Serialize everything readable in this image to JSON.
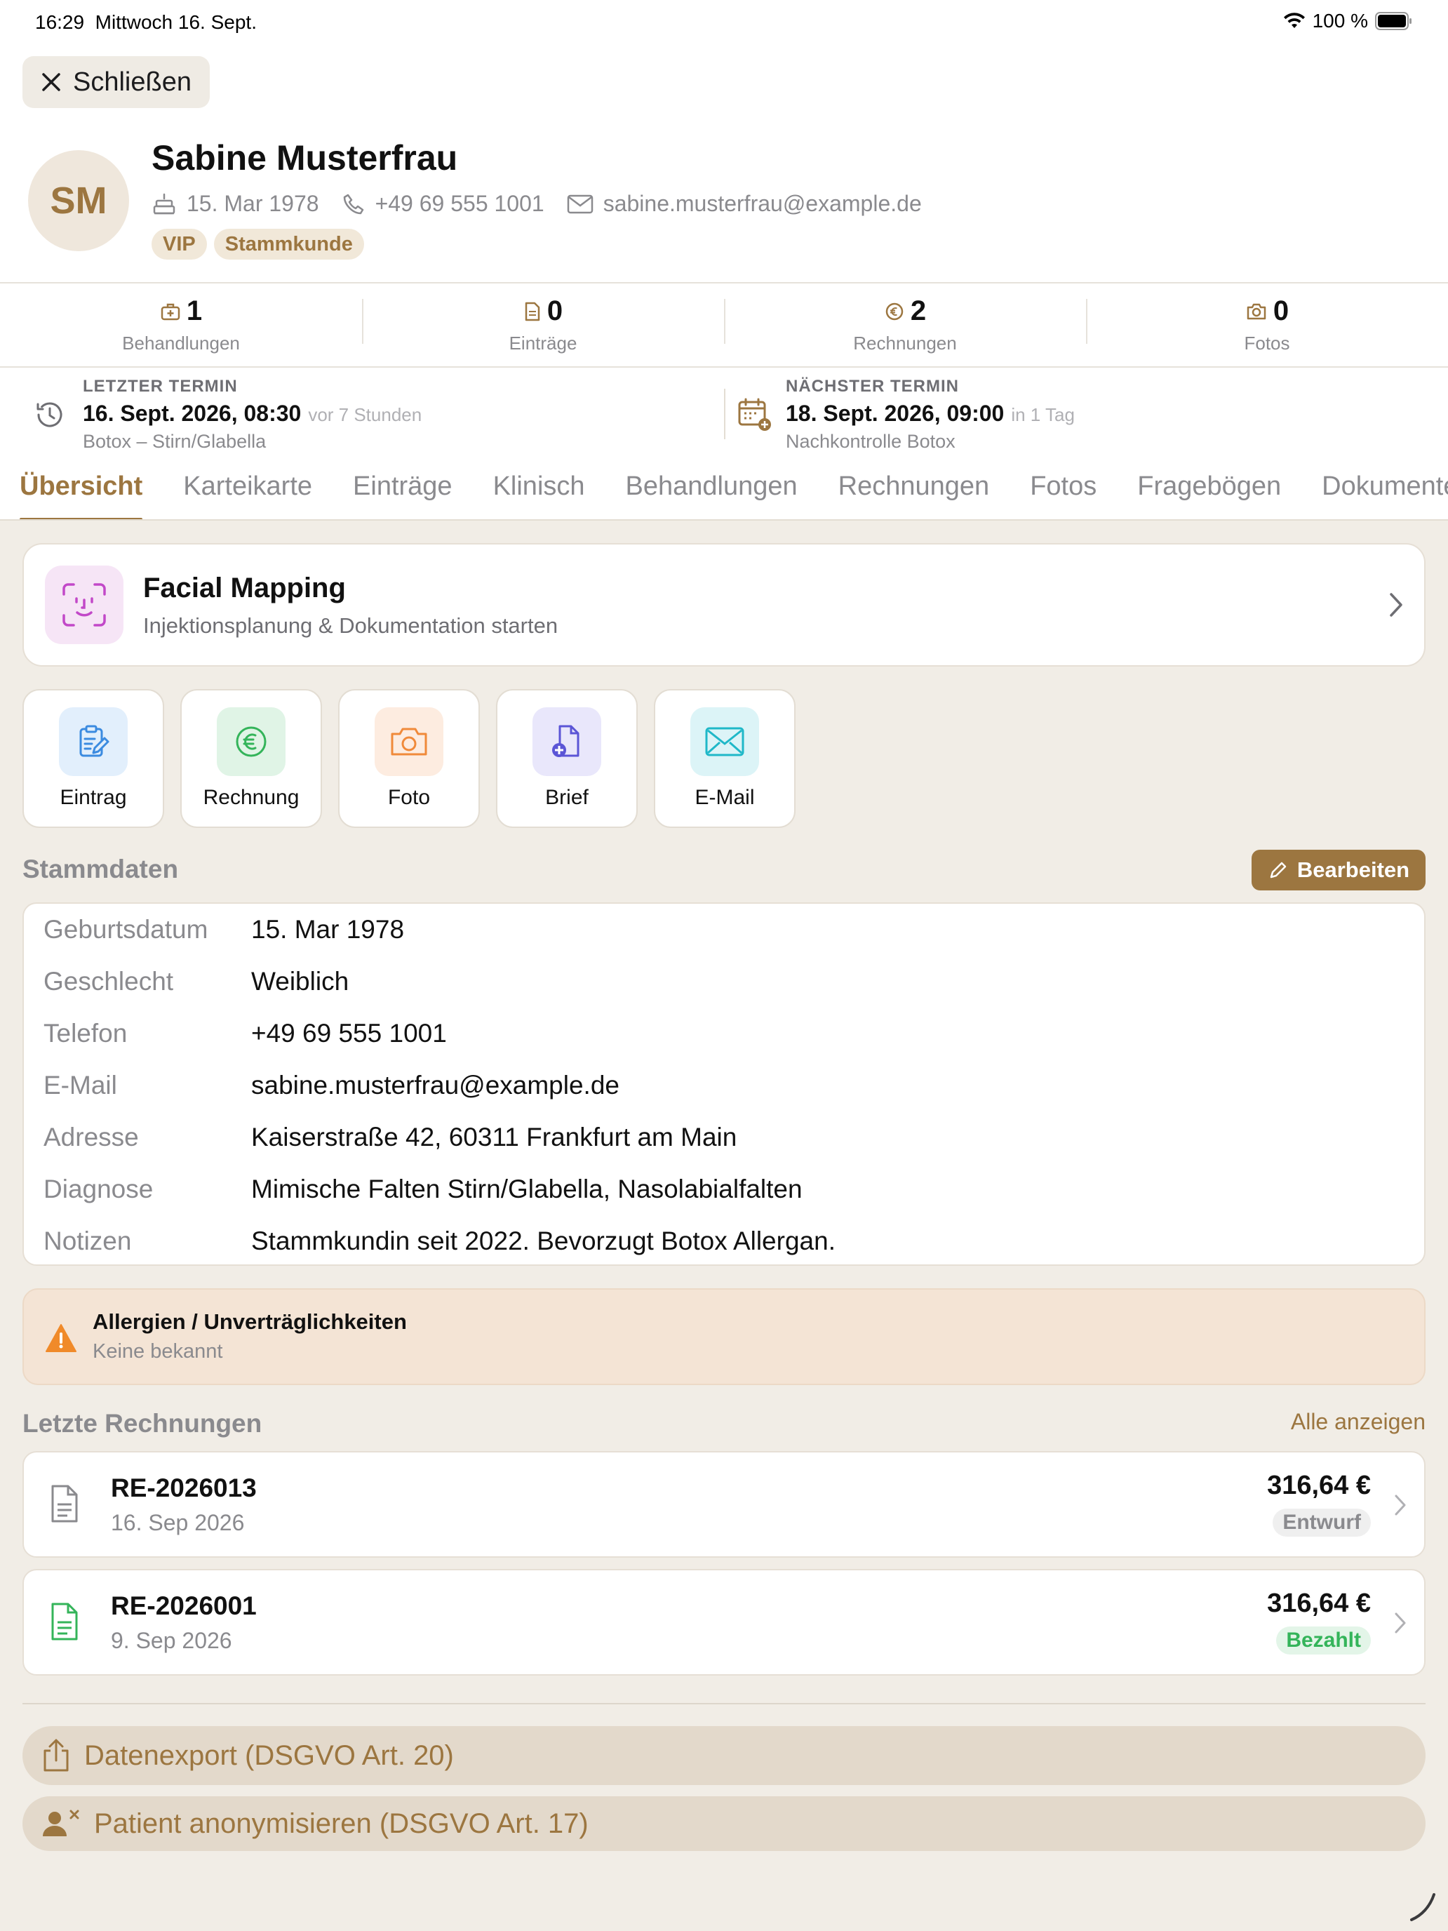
{
  "status_bar": {
    "time": "16:29",
    "date": "Mittwoch 16. Sept.",
    "battery": "100 %"
  },
  "header": {
    "close_label": "Schließen"
  },
  "patient": {
    "initials": "SM",
    "name": "Sabine Musterfrau",
    "birthdate": "15. Mar 1978",
    "phone": "+49 69 555 1001",
    "email": "sabine.musterfrau@example.de",
    "tags": [
      "VIP",
      "Stammkunde"
    ]
  },
  "stats": [
    {
      "icon": "treatment-kit-icon",
      "value": "1",
      "label": "Behandlungen"
    },
    {
      "icon": "document-icon",
      "value": "0",
      "label": "Einträge"
    },
    {
      "icon": "euro-circle-icon",
      "value": "2",
      "label": "Rechnungen"
    },
    {
      "icon": "camera-icon",
      "value": "0",
      "label": "Fotos"
    }
  ],
  "appointments": {
    "last": {
      "caption": "LETZTER TERMIN",
      "date": "16. Sept. 2026, 08:30",
      "relative": "vor 7 Stunden",
      "detail": "Botox – Stirn/Glabella"
    },
    "next": {
      "caption": "NÄCHSTER TERMIN",
      "date": "18. Sept. 2026, 09:00",
      "relative": "in 1 Tag",
      "detail": "Nachkontrolle Botox"
    }
  },
  "tabs": [
    "Übersicht",
    "Karteikarte",
    "Einträge",
    "Klinisch",
    "Behandlungen",
    "Rechnungen",
    "Fotos",
    "Fragebögen",
    "Dokumente"
  ],
  "active_tab": "Übersicht",
  "facial_mapping": {
    "title": "Facial Mapping",
    "subtitle": "Injektionsplanung & Dokumentation starten"
  },
  "quick_actions": [
    {
      "label": "Eintrag",
      "icon": "clipboard-edit-icon",
      "color": "#3b8be0"
    },
    {
      "label": "Rechnung",
      "icon": "euro-circle-icon",
      "color": "#34b45a"
    },
    {
      "label": "Foto",
      "icon": "camera-icon",
      "color": "#f08a3a"
    },
    {
      "label": "Brief",
      "icon": "document-add-icon",
      "color": "#5b55d6"
    },
    {
      "label": "E-Mail",
      "icon": "mail-icon",
      "color": "#1fb8c8"
    }
  ],
  "master_data": {
    "title": "Stammdaten",
    "edit_label": "Bearbeiten",
    "rows": [
      {
        "key": "Geburtsdatum",
        "value": "15. Mar 1978"
      },
      {
        "key": "Geschlecht",
        "value": "Weiblich"
      },
      {
        "key": "Telefon",
        "value": "+49 69 555 1001"
      },
      {
        "key": "E-Mail",
        "value": "sabine.musterfrau@example.de"
      },
      {
        "key": "Adresse",
        "value": "Kaiserstraße 42, 60311 Frankfurt am Main"
      },
      {
        "key": "Diagnose",
        "value": "Mimische Falten Stirn/Glabella, Nasolabialfalten"
      },
      {
        "key": "Notizen",
        "value": "Stammkundin seit 2022. Bevorzugt Botox Allergan."
      }
    ]
  },
  "allergies": {
    "title": "Allergien / Unverträglichkeiten",
    "value": "Keine bekannt"
  },
  "invoices": {
    "title": "Letzte Rechnungen",
    "show_all": "Alle anzeigen",
    "items": [
      {
        "number": "RE-2026013",
        "date": "16. Sep 2026",
        "amount": "316,64 €",
        "status": "Entwurf",
        "status_color": "#8a8a8e"
      },
      {
        "number": "RE-2026001",
        "date": "9. Sep 2026",
        "amount": "316,64 €",
        "status": "Bezahlt",
        "status_color": "#34b45a"
      }
    ]
  },
  "gdpr": {
    "export_label": "Datenexport (DSGVO Art. 20)",
    "anonymize_label": "Patient anonymisieren (DSGVO Art. 17)"
  },
  "colors": {
    "accent": "#9c7640",
    "background": "#f1ede6",
    "warning": "#f08a2a"
  }
}
